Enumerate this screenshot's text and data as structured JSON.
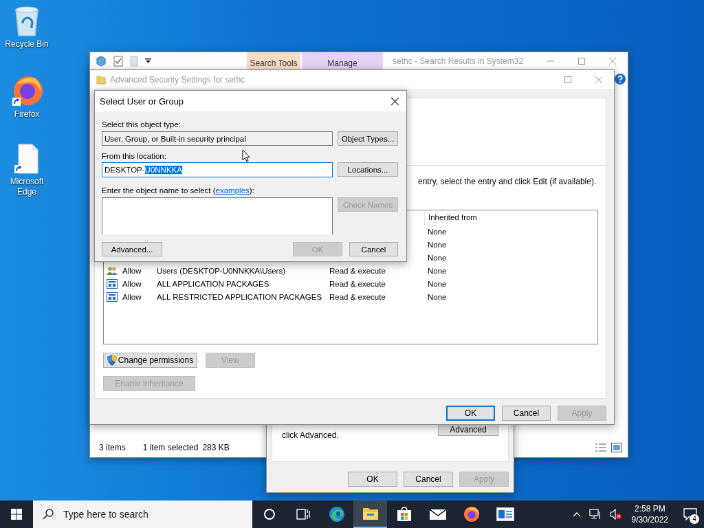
{
  "desktop_icons": [
    {
      "kind": "recycle-bin",
      "label": "Recycle Bin"
    },
    {
      "kind": "firefox",
      "label": "Firefox"
    },
    {
      "kind": "file",
      "label": "Microsoft Edge"
    }
  ],
  "explorer": {
    "title": "sethc - Search Results in System32",
    "ribbon_tabs": [
      {
        "label": "Search Tools",
        "color": "#fadcc8"
      },
      {
        "label": "Manage",
        "color": "#e6d2f5"
      }
    ],
    "status_bar": {
      "items": "3 items",
      "selected": "1 item selected",
      "size": "283 KB"
    }
  },
  "properties": {
    "note": [
      "click Advanced."
    ],
    "advanced_button": "Advanced",
    "buttons": [
      {
        "label": "OK",
        "disabled": false
      },
      {
        "label": "Cancel",
        "disabled": false
      },
      {
        "label": "Apply",
        "disabled": true
      }
    ]
  },
  "security": {
    "title": "Advanced Security Settings for sethc",
    "instruction": "entry, select the entry and click Edit (if available).",
    "inherited_column": "Inherited from",
    "rows": [
      {
        "inherited": "None"
      },
      {
        "inherited": "None"
      },
      {
        "inherited": "None"
      },
      {
        "kind": "group",
        "type": "Allow",
        "principal": "Users (DESKTOP-U0NNKKA\\Users)",
        "access": "Read & execute",
        "inherited": "None"
      },
      {
        "kind": "package",
        "type": "Allow",
        "principal": "ALL APPLICATION PACKAGES",
        "access": "Read & execute",
        "inherited": "None"
      },
      {
        "kind": "package",
        "type": "Allow",
        "principal": "ALL RESTRICTED APPLICATION PACKAGES",
        "access": "Read & execute",
        "inherited": "None"
      }
    ],
    "change_permissions": "Change permissions",
    "view": {
      "label": "View",
      "disabled": true
    },
    "inheritance": {
      "label": "Enable inheritance",
      "disabled": true
    },
    "buttons": [
      {
        "label": "OK",
        "disabled": false,
        "default": true
      },
      {
        "label": "Cancel",
        "disabled": false,
        "default": false
      },
      {
        "label": "Apply",
        "disabled": true,
        "default": false
      }
    ]
  },
  "dialog": {
    "title": "Select User or Group",
    "type_label": "Select this object type:",
    "object_type": "User, Group, or Built-in security principal",
    "object_types_button": "Object Types...",
    "location_label": "From this location:",
    "location": {
      "prefix": "DESKTOP-",
      "selected": "U0NNKKA"
    },
    "locations_button": "Locations...",
    "name_prompt": {
      "before": "Enter the object name to select (",
      "link": "examples",
      "after": "):"
    },
    "check_names": {
      "label": "Check Names",
      "disabled": true
    },
    "buttons": [
      {
        "label": "Advanced...",
        "disabled": false
      },
      {
        "label": "OK",
        "disabled": true
      },
      {
        "label": "Cancel",
        "disabled": false
      }
    ]
  },
  "taskbar": {
    "search_placeholder": "Type here to search",
    "apps": [
      {
        "kind": "cortana",
        "selected": false
      },
      {
        "kind": "task-view",
        "selected": false
      },
      {
        "kind": "edge",
        "selected": false
      },
      {
        "kind": "explorer",
        "selected": true
      },
      {
        "kind": "store",
        "selected": false
      },
      {
        "kind": "mail",
        "selected": false
      },
      {
        "kind": "firefox",
        "selected": false
      },
      {
        "kind": "app",
        "selected": false
      }
    ],
    "time": "2:58 PM",
    "date": "9/30/2022",
    "notifications": "4"
  }
}
